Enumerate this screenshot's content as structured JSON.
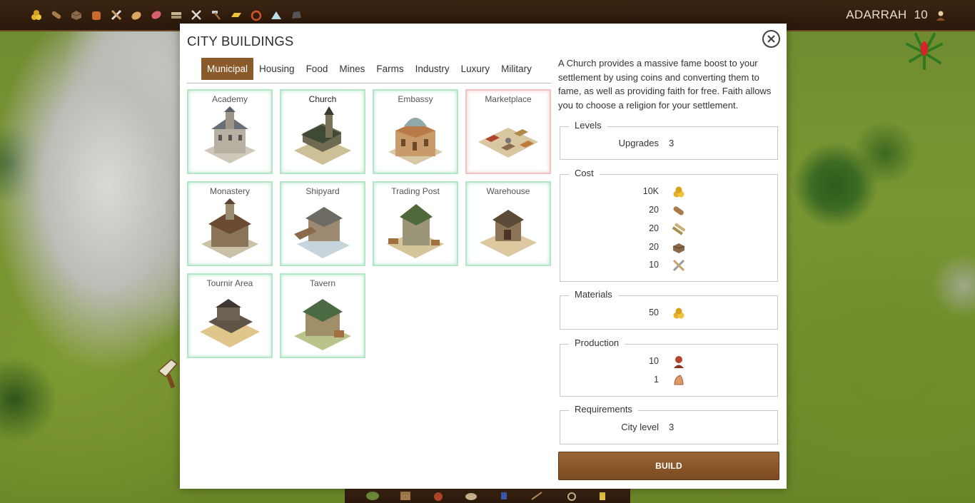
{
  "topbar": {
    "resource_icons": [
      "gold-coins-icon",
      "wood-log-icon",
      "stone-block-icon",
      "copper-pot-icon",
      "tools-icon",
      "bread-icon",
      "meat-icon",
      "planks-icon",
      "crossed-swords-icon",
      "hammer-icon",
      "gold-bar-icon",
      "rope-icon",
      "salt-pile-icon",
      "coal-icon"
    ],
    "player_name": "ADARRAH",
    "player_level": "10"
  },
  "dialog": {
    "title": "CITY BUILDINGS",
    "tabs": [
      "Municipal",
      "Housing",
      "Food",
      "Mines",
      "Farms",
      "Industry",
      "Luxury",
      "Military"
    ],
    "active_tab": "Municipal",
    "buildings": [
      {
        "name": "Academy",
        "status": "available"
      },
      {
        "name": "Church",
        "status": "selected"
      },
      {
        "name": "Embassy",
        "status": "available"
      },
      {
        "name": "Marketplace",
        "status": "unavailable"
      },
      {
        "name": "Monastery",
        "status": "available"
      },
      {
        "name": "Shipyard",
        "status": "available"
      },
      {
        "name": "Trading Post",
        "status": "available"
      },
      {
        "name": "Warehouse",
        "status": "available"
      },
      {
        "name": "Tournir Area",
        "status": "available"
      },
      {
        "name": "Tavern",
        "status": "available"
      }
    ]
  },
  "details": {
    "description": "A Church provides a massive fame boost to your settlement by using coins and converting them to fame, as well as providing faith for free. Faith allows you to choose a religion for your settlement.",
    "levels": {
      "legend": "Levels",
      "label": "Upgrades",
      "value": "3"
    },
    "cost": {
      "legend": "Cost",
      "items": [
        {
          "amount": "10K",
          "icon": "gold-coins-icon"
        },
        {
          "amount": "20",
          "icon": "wood-log-icon"
        },
        {
          "amount": "20",
          "icon": "planks-icon"
        },
        {
          "amount": "20",
          "icon": "stone-block-icon"
        },
        {
          "amount": "10",
          "icon": "tools-icon"
        }
      ]
    },
    "materials": {
      "legend": "Materials",
      "items": [
        {
          "amount": "50",
          "icon": "gold-coins-icon"
        }
      ]
    },
    "production": {
      "legend": "Production",
      "items": [
        {
          "amount": "10",
          "icon": "fame-bust-icon"
        },
        {
          "amount": "1",
          "icon": "praying-hands-icon"
        }
      ]
    },
    "requirements": {
      "legend": "Requirements",
      "label": "City level",
      "value": "3"
    },
    "build_label": "BUILD"
  },
  "colors": {
    "accent": "#8b5a2b",
    "card_available": "#b5e6c8",
    "card_unavailable": "#f0c2c2",
    "topbar": "#2f1c0d"
  }
}
